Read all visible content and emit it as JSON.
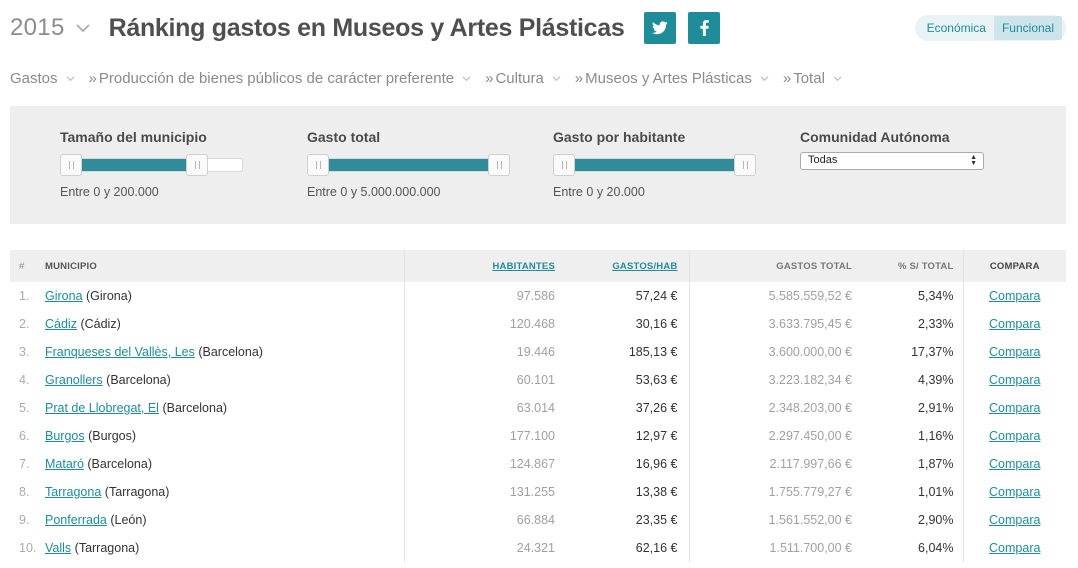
{
  "header": {
    "year": "2015",
    "title": "Ránking gastos en Museos y Artes Plásticas",
    "social": [
      "twitter-icon",
      "facebook-icon"
    ],
    "toggle": [
      "Económica",
      "Funcional"
    ],
    "toggle_active": "Funcional"
  },
  "breadcrumb": [
    {
      "label": "Gastos",
      "sep": ""
    },
    {
      "label": "Producción de bienes públicos de carácter preferente",
      "sep": "»"
    },
    {
      "label": "Cultura",
      "sep": "»"
    },
    {
      "label": "Museos y Artes Plásticas",
      "sep": "»"
    },
    {
      "label": "Total",
      "sep": "»"
    }
  ],
  "filters": {
    "size": {
      "label": "Tamaño del municipio",
      "range_prefix": "Entre",
      "min": "0",
      "conj": "y",
      "max": "200.000"
    },
    "total": {
      "label": "Gasto total",
      "range_prefix": "Entre",
      "min": "0",
      "conj": "y",
      "max": "5.000.000.000"
    },
    "per_capita": {
      "label": "Gasto por habitante",
      "range_prefix": "Entre",
      "min": "0",
      "conj": "y",
      "max": "20.000"
    },
    "region": {
      "label": "Comunidad Autónoma",
      "selected": "Todas"
    }
  },
  "table": {
    "headers": {
      "rank": "#",
      "municipio": "Municipio",
      "habitantes": "Habitantes",
      "gastos_hab": "Gastos/hab",
      "gastos_total": "Gastos total",
      "pct": "% s/ total",
      "compara": "Compara"
    },
    "rows": [
      {
        "rank": "1.",
        "name": "Girona",
        "province": "(Girona)",
        "habitantes": "97.586",
        "gastos_hab": "57,24 €",
        "gastos_total": "5.585.559,52 €",
        "pct": "5,34%",
        "compara": "Compara"
      },
      {
        "rank": "2.",
        "name": "Cádiz",
        "province": "(Cádiz)",
        "habitantes": "120.468",
        "gastos_hab": "30,16 €",
        "gastos_total": "3.633.795,45 €",
        "pct": "2,33%",
        "compara": "Compara"
      },
      {
        "rank": "3.",
        "name": "Franqueses del Vallès, Les",
        "province": "(Barcelona)",
        "habitantes": "19.446",
        "gastos_hab": "185,13 €",
        "gastos_total": "3.600.000,00 €",
        "pct": "17,37%",
        "compara": "Compara"
      },
      {
        "rank": "4.",
        "name": "Granollers",
        "province": "(Barcelona)",
        "habitantes": "60.101",
        "gastos_hab": "53,63 €",
        "gastos_total": "3.223.182,34 €",
        "pct": "4,39%",
        "compara": "Compara"
      },
      {
        "rank": "5.",
        "name": "Prat de Llobregat, El",
        "province": "(Barcelona)",
        "habitantes": "63.014",
        "gastos_hab": "37,26 €",
        "gastos_total": "2.348.203,00 €",
        "pct": "2,91%",
        "compara": "Compara"
      },
      {
        "rank": "6.",
        "name": "Burgos",
        "province": "(Burgos)",
        "habitantes": "177.100",
        "gastos_hab": "12,97 €",
        "gastos_total": "2.297.450,00 €",
        "pct": "1,16%",
        "compara": "Compara"
      },
      {
        "rank": "7.",
        "name": "Mataró",
        "province": "(Barcelona)",
        "habitantes": "124.867",
        "gastos_hab": "16,96 €",
        "gastos_total": "2.117.997,66 €",
        "pct": "1,87%",
        "compara": "Compara"
      },
      {
        "rank": "8.",
        "name": "Tarragona",
        "province": "(Tarragona)",
        "habitantes": "131.255",
        "gastos_hab": "13,38 €",
        "gastos_total": "1.755.779,27 €",
        "pct": "1,01%",
        "compara": "Compara"
      },
      {
        "rank": "9.",
        "name": "Ponferrada",
        "province": "(León)",
        "habitantes": "66.884",
        "gastos_hab": "23,35 €",
        "gastos_total": "1.561.552,00 €",
        "pct": "2,90%",
        "compara": "Compara"
      },
      {
        "rank": "10.",
        "name": "Valls",
        "province": "(Tarragona)",
        "habitantes": "24.321",
        "gastos_hab": "62,16 €",
        "gastos_total": "1.511.700,00 €",
        "pct": "6,04%",
        "compara": "Compara"
      }
    ]
  },
  "colors": {
    "accent": "#1f8c9a",
    "slider_fill": "#2f8c98",
    "panel_bg": "#eeeeee"
  }
}
